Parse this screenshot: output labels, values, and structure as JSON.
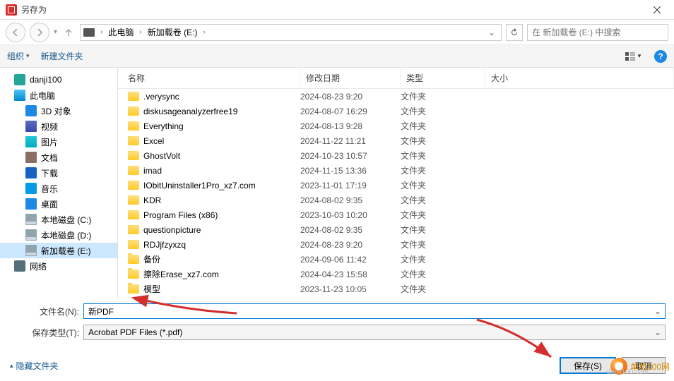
{
  "titlebar": {
    "title": "另存为"
  },
  "path": {
    "thisPC": "此电脑",
    "drive": "新加载卷 (E:)"
  },
  "search": {
    "placeholder": "在 新加载卷 (E:) 中搜索"
  },
  "toolbar": {
    "organize": "组织",
    "newFolder": "新建文件夹"
  },
  "sidebar": {
    "items": [
      {
        "label": "danji100",
        "icon": "ico-sq-teal",
        "lvl": 1
      },
      {
        "label": "此电脑",
        "icon": "ico-pc",
        "lvl": 1
      },
      {
        "label": "3D 对象",
        "icon": "ico-3d",
        "lvl": 2
      },
      {
        "label": "视频",
        "icon": "ico-video",
        "lvl": 2
      },
      {
        "label": "图片",
        "icon": "ico-pic",
        "lvl": 2
      },
      {
        "label": "文档",
        "icon": "ico-doc",
        "lvl": 2
      },
      {
        "label": "下载",
        "icon": "ico-dl",
        "lvl": 2
      },
      {
        "label": "音乐",
        "icon": "ico-music",
        "lvl": 2
      },
      {
        "label": "桌面",
        "icon": "ico-desk",
        "lvl": 2
      },
      {
        "label": "本地磁盘 (C:)",
        "icon": "ico-drv",
        "lvl": 2
      },
      {
        "label": "本地磁盘 (D:)",
        "icon": "ico-drv",
        "lvl": 2
      },
      {
        "label": "新加载卷 (E:)",
        "icon": "ico-drv",
        "lvl": 2,
        "sel": true
      },
      {
        "label": "网络",
        "icon": "ico-net",
        "lvl": 1
      }
    ]
  },
  "columns": {
    "name": "名称",
    "date": "修改日期",
    "type": "类型",
    "size": "大小"
  },
  "files": [
    {
      "name": ".verysync",
      "date": "2024-08-23 9:20",
      "type": "文件夹"
    },
    {
      "name": "diskusageanalyzerfree19",
      "date": "2024-08-07 16:29",
      "type": "文件夹"
    },
    {
      "name": "Everything",
      "date": "2024-08-13 9:28",
      "type": "文件夹"
    },
    {
      "name": "Excel",
      "date": "2024-11-22 11:21",
      "type": "文件夹"
    },
    {
      "name": "GhostVolt",
      "date": "2024-10-23 10:57",
      "type": "文件夹"
    },
    {
      "name": "imad",
      "date": "2024-11-15 13:36",
      "type": "文件夹"
    },
    {
      "name": "IObitUninstaller1Pro_xz7.com",
      "date": "2023-11-01 17:19",
      "type": "文件夹"
    },
    {
      "name": "KDR",
      "date": "2024-08-02 9:35",
      "type": "文件夹"
    },
    {
      "name": "Program Files (x86)",
      "date": "2023-10-03 10:20",
      "type": "文件夹"
    },
    {
      "name": "questionpicture",
      "date": "2024-08-02 9:35",
      "type": "文件夹"
    },
    {
      "name": "RDJjfzyxzq",
      "date": "2024-08-23 9:20",
      "type": "文件夹"
    },
    {
      "name": "备份",
      "date": "2024-09-06 11:42",
      "type": "文件夹"
    },
    {
      "name": "擦除Erase_xz7.com",
      "date": "2024-04-23 15:58",
      "type": "文件夹"
    },
    {
      "name": "模型",
      "date": "2023-11-23 10:05",
      "type": "文件夹"
    }
  ],
  "fields": {
    "fileNameLabel": "文件名(N):",
    "fileNameValue": "新PDF",
    "saveTypeLabel": "保存类型(T):",
    "saveTypeValue": "Acrobat PDF Files (*.pdf)"
  },
  "footer": {
    "hideFolders": "隐藏文件夹",
    "save": "保存(S)",
    "cancel": "取消"
  },
  "watermark": {
    "brand": "单机100网",
    "url": "danji100.com"
  }
}
